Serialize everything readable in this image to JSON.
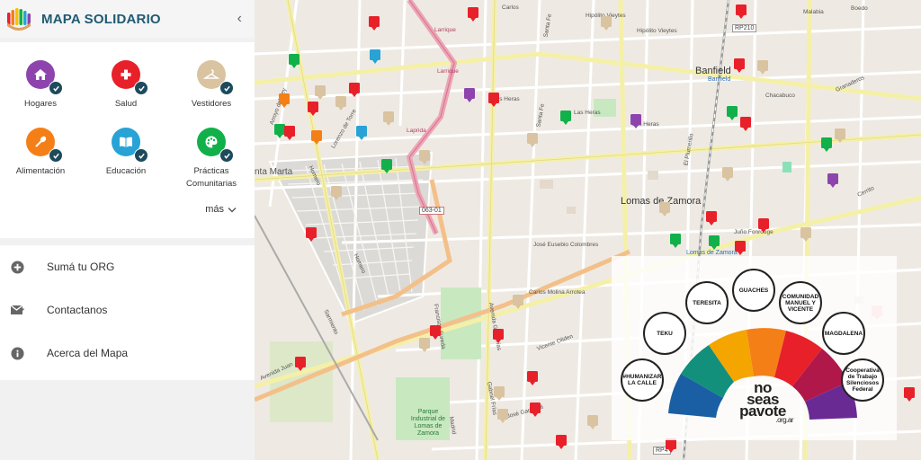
{
  "app": {
    "title": "MAPA SOLIDARIO",
    "collapse_icon": "chevron-left-icon"
  },
  "categories": [
    {
      "label": "Hogares",
      "icon": "home-icon",
      "color": "#8e44ad"
    },
    {
      "label": "Salud",
      "icon": "cross-icon",
      "color": "#e8202a"
    },
    {
      "label": "Vestidores",
      "icon": "hanger-icon",
      "color": "#d9c3a0"
    },
    {
      "label": "Alimentación",
      "icon": "spoon-icon",
      "color": "#f57f17"
    },
    {
      "label": "Educación",
      "icon": "book-icon",
      "color": "#29a3d6"
    },
    {
      "label": "Prácticas Comunitarias",
      "icon": "palette-icon",
      "color": "#12b04a"
    }
  ],
  "more_label": "más",
  "menu": [
    {
      "label": "Sumá tu ORG",
      "icon": "add-circle-icon"
    },
    {
      "label": "Contactanos",
      "icon": "mail-icon"
    },
    {
      "label": "Acerca del Mapa",
      "icon": "info-icon"
    }
  ],
  "map_labels": {
    "banfield": "Banfield",
    "banfield_station": "Banfield",
    "lomas": "Lomas de Zamora",
    "lomas_station": "Lomas de Zamora",
    "santa_marta": "nta Marta",
    "parque": "Parque Industrial de Lomas de Zamora",
    "route_063": "063-01",
    "route_rp210": "RP210",
    "route_rp4": "RP4"
  },
  "street_labels": [
    "Larrique",
    "Larrique",
    "Laprida",
    "Las Heras",
    "Las Heras",
    "Las Heras",
    "Chacabuco",
    "Granaderos",
    "Hipólito Vieytes",
    "Hipólito Vieytes",
    "Carlos",
    "Santa Fe",
    "Santa Fe",
    "Juño Fonrouge",
    "José Eusebio Colombres",
    "Carlos Molina Arrotea",
    "Vicente Oliden",
    "Cerrito",
    "Sarmiento",
    "Homero",
    "Homero",
    "Avenida Juan",
    "Arroyo del Rey",
    "Lorenzo de Torre",
    "Gabriel Frías",
    "Avenida Gral Frías",
    "Francisco Sureda",
    "José Garibaldi",
    "Madrid",
    "El Plumerillo",
    "Malabia",
    "Boedo"
  ],
  "overlay": {
    "orgs": [
      "TEKU",
      "TERESITA",
      "GUACHES",
      "COMUNIDAD MANUEL Y VICENTE",
      "MAGDALENA",
      "#HUMANIZAR LA CALLE",
      "Cooperativa de Trabajo Silenciosos Federal"
    ],
    "brand_line1": "no",
    "brand_line2": "seas",
    "brand_line3": "pavote",
    "brand_suffix": ".org.ar"
  }
}
